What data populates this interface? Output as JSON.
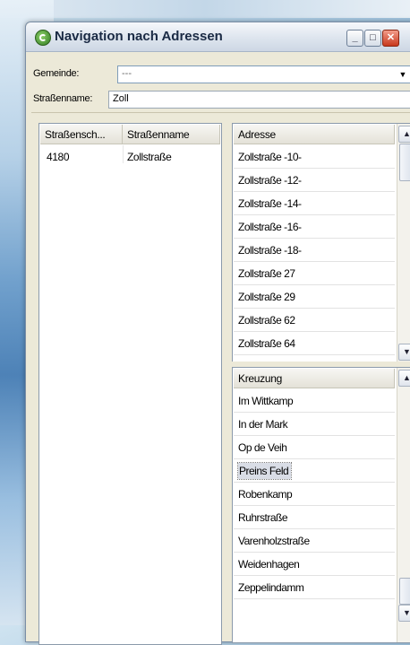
{
  "window": {
    "title": "Navigation nach Adressen",
    "buttons": {
      "minimize": "_",
      "maximize": "□",
      "close": "✕"
    }
  },
  "form": {
    "gemeinde_label": "Gemeinde:",
    "gemeinde_value": "---",
    "strassenname_label": "Straßenname:",
    "strassenname_value": "Zoll"
  },
  "streets_table": {
    "columns": [
      "Straßensch...",
      "Straßenname"
    ],
    "rows": [
      {
        "code": "4180",
        "name": "Zollstraße"
      }
    ]
  },
  "address_list": {
    "header": "Adresse",
    "items": [
      "Zollstraße -10-",
      "Zollstraße -12-",
      "Zollstraße -14-",
      "Zollstraße -16-",
      "Zollstraße -18-",
      "Zollstraße 27",
      "Zollstraße 29",
      "Zollstraße 62",
      "Zollstraße 64"
    ]
  },
  "crossing_list": {
    "header": "Kreuzung",
    "items": [
      "Im Wittkamp",
      "In der Mark",
      "Op de Veih",
      "Preins Feld",
      "Robenkamp",
      "Ruhrstraße",
      "Varenholzstraße",
      "Weidenhagen",
      "Zeppelindamm"
    ],
    "selected": "Preins Feld"
  },
  "icons": {
    "app": "app-icon",
    "combo_arrow": "▼",
    "scroll_up": "▲",
    "scroll_down": "▼"
  }
}
